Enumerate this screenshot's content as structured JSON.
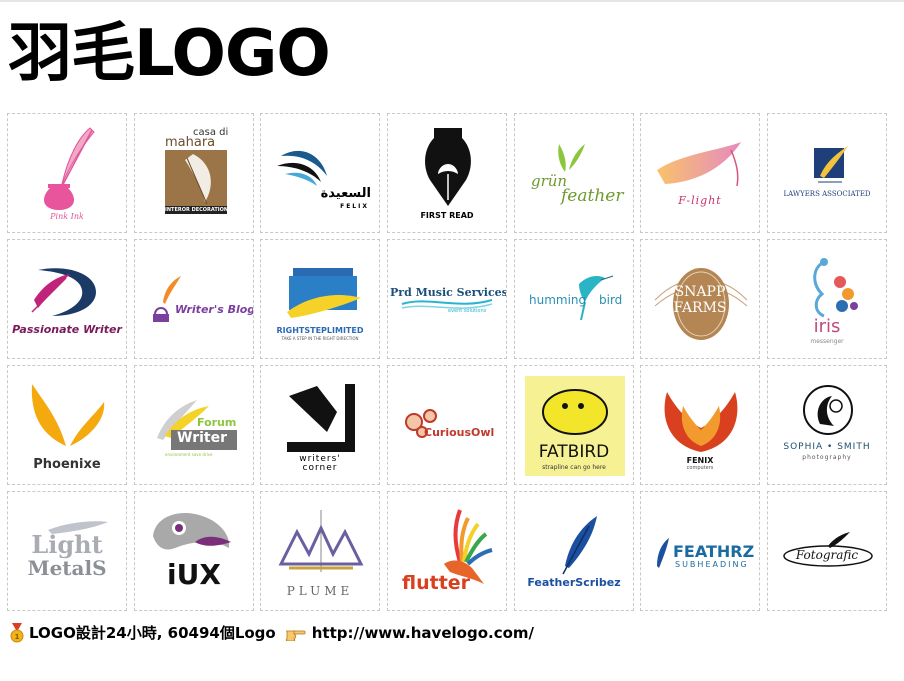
{
  "page": {
    "title": "羽毛LOGO"
  },
  "logos": [
    {
      "name": "Pink Ink",
      "sub": ""
    },
    {
      "name": "casa di",
      "name2": "mahara",
      "sub": "INTEROR DECORATION"
    },
    {
      "name": "السعيدة",
      "sub": "FELIX"
    },
    {
      "name": "FIRST READ",
      "sub": ""
    },
    {
      "name": "grün",
      "name2": "feather",
      "sub": ""
    },
    {
      "name": "F-light",
      "sub": ""
    },
    {
      "name": "LAWYERS ASSOCIATED",
      "sub": ""
    },
    {
      "name": "Passionate Writer",
      "sub": ""
    },
    {
      "name": "Writer's Blog",
      "sub": ""
    },
    {
      "name": "RIGHTSTEPLIMITED",
      "sub": "TAKE A STEP IN THE RIGHT DIRECTION"
    },
    {
      "name": "Prd Music Services",
      "sub": "event solutions"
    },
    {
      "name": "humming",
      "name2": "bird",
      "sub": ""
    },
    {
      "name": "SNAPP",
      "name2": "FARMS",
      "sub": ""
    },
    {
      "name": "iris",
      "sub": "messenger"
    },
    {
      "name": "Phoenixe",
      "sub": ""
    },
    {
      "name": "Forum",
      "name2": "Writer",
      "sub": "environment save drive"
    },
    {
      "name": "writers'",
      "name2": "corner",
      "sub": ""
    },
    {
      "name": "CuriousOwl",
      "sub": ""
    },
    {
      "name": "FATBIRD",
      "sub": "strapline can go here"
    },
    {
      "name": "FENIX",
      "sub": "computers"
    },
    {
      "name": "SOPHIA • SMITH",
      "sub": "photography"
    },
    {
      "name": "Light",
      "name2": "MetalS",
      "sub": ""
    },
    {
      "name": "iUX",
      "sub": ""
    },
    {
      "name": "PLUME",
      "sub": ""
    },
    {
      "name": "flutter",
      "sub": ""
    },
    {
      "name": "FeatherScribez",
      "sub": ""
    },
    {
      "name": "FEATHRZ",
      "sub": "SUBHEADING"
    },
    {
      "name": "Fotografic",
      "sub": ""
    }
  ],
  "footer": {
    "text": "LOGO設計24小時, 60494個Logo",
    "link": "http://www.havelogo.com/",
    "medal_icon": "medal-icon",
    "hand_icon": "pointing-hand-icon"
  }
}
